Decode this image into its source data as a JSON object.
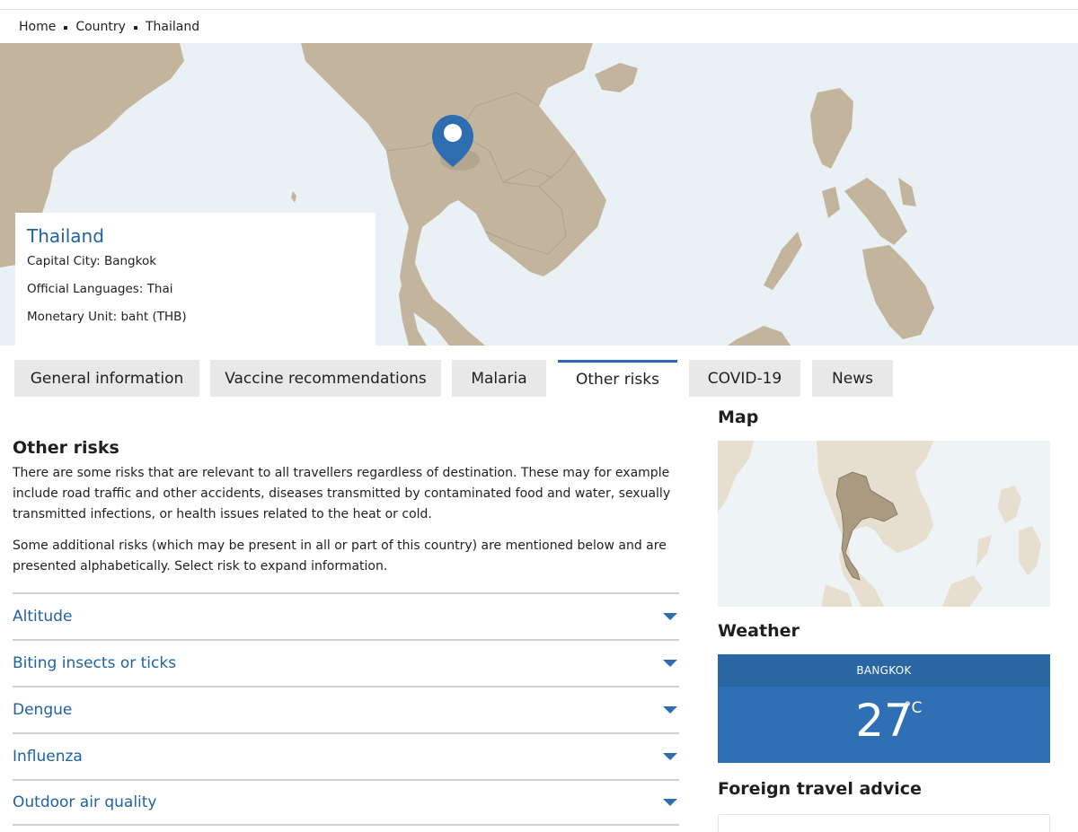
{
  "breadcrumb": {
    "items": [
      "Home",
      "Country",
      "Thailand"
    ]
  },
  "country": {
    "name": "Thailand",
    "capital": "Capital City: Bangkok",
    "languages": "Official Languages: Thai",
    "currency": "Monetary Unit: baht (THB)"
  },
  "tabs": [
    {
      "label": "General information",
      "active": false
    },
    {
      "label": "Vaccine recommendations",
      "active": false
    },
    {
      "label": "Malaria",
      "active": false
    },
    {
      "label": "Other risks",
      "active": true
    },
    {
      "label": "COVID-19",
      "active": false
    },
    {
      "label": "News",
      "active": false
    }
  ],
  "main": {
    "title": "Other risks",
    "paragraph1": "There are some risks that are relevant to all travellers regardless of destination. These may for example include road traffic and other accidents, diseases transmitted by contaminated food and water, sexually transmitted infections, or health issues related to the heat or cold.",
    "paragraph2": "Some additional risks (which may be present in all or part of this country) are mentioned below and are presented alphabetically. Select risk to expand information.",
    "risks": [
      "Altitude",
      "Biting insects or ticks",
      "Dengue",
      "Influenza",
      "Outdoor air quality"
    ]
  },
  "sidebar": {
    "map_title": "Map",
    "weather_title": "Weather",
    "weather_city": "BANGKOK",
    "weather_temp": "27",
    "weather_unit": "°C",
    "advice_title": "Foreign travel advice"
  },
  "colors": {
    "link_blue": "#1e62a3",
    "land": "#c3b59d",
    "sea": "#e9f1f5",
    "weather_bg": "#2f6fb3",
    "pin": "#2e6db0"
  },
  "icons": {
    "map_pin": "map-pin-icon",
    "expand": "triangle-down-icon"
  }
}
